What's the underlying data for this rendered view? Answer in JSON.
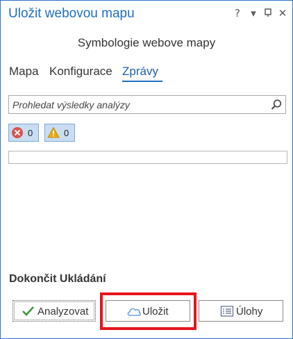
{
  "window": {
    "title": "Uložit webovou mapu",
    "help_glyph": "?",
    "menu_glyph": "▾",
    "pin_glyph": "⊕",
    "close_glyph": "✕"
  },
  "subtitle": "Symbologie webove mapy",
  "tabs": [
    {
      "label": "Mapa",
      "active": false
    },
    {
      "label": "Konfigurace",
      "active": false
    },
    {
      "label": "Zprávy",
      "active": true
    }
  ],
  "search": {
    "placeholder": "Prohledat výsledky analýzy",
    "icon": "search-icon"
  },
  "filters": {
    "errors": {
      "icon": "error-icon",
      "count": "0",
      "color": "#d9534f"
    },
    "warnings": {
      "icon": "warning-icon",
      "count": "0",
      "color": "#f0ad00"
    }
  },
  "finish": {
    "title": "Dokončit Ukládání"
  },
  "buttons": {
    "analyze": {
      "label": "Analyzovat",
      "icon": "checkmark-icon"
    },
    "save": {
      "label": "Uložit",
      "icon": "cloud-icon"
    },
    "tasks": {
      "label": "Úlohy",
      "icon": "list-icon"
    }
  },
  "colors": {
    "accent": "#1f6fc0",
    "highlight": "#e8141c"
  }
}
